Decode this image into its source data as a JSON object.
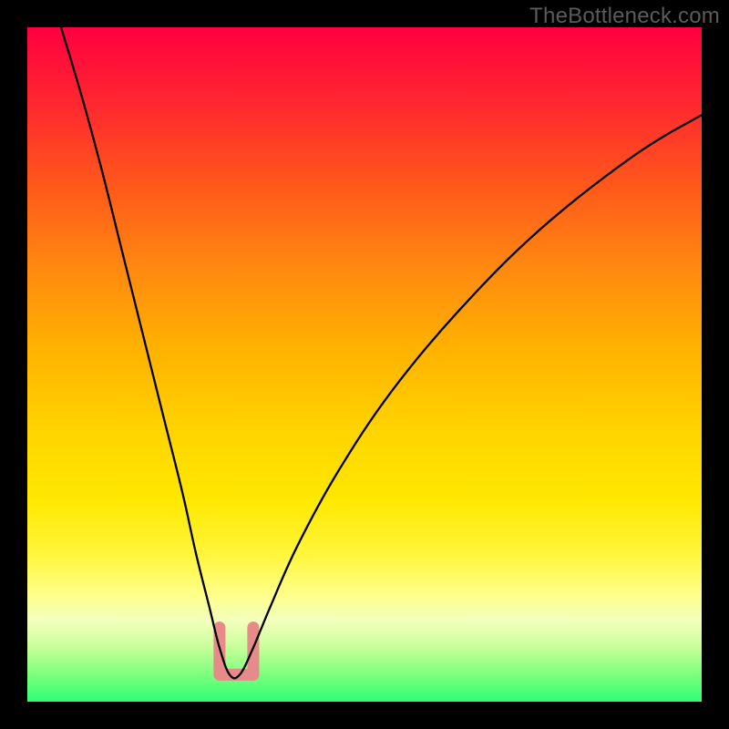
{
  "watermark": "TheBottleneck.com",
  "chart_data": {
    "type": "line",
    "title": "",
    "xlabel": "",
    "ylabel": "",
    "xlim": [
      0,
      100
    ],
    "ylim": [
      0,
      100
    ],
    "grid": false,
    "background_gradient": {
      "top_color": "#ff0040",
      "bottom_color": "#2cff76",
      "meaning": "high (red) to low (green) bottleneck"
    },
    "series": [
      {
        "name": "bottleneck-curve",
        "color": "#000000",
        "x": [
          5,
          8,
          11,
          14,
          17,
          20,
          23,
          25,
          27,
          28.5,
          30,
          31.5,
          33.5,
          36,
          40,
          46,
          54,
          64,
          76,
          90,
          100
        ],
        "values": [
          100,
          90,
          79,
          67,
          55,
          43,
          31,
          22,
          14,
          8,
          4,
          4,
          8,
          14,
          23,
          34,
          46,
          58,
          70,
          81,
          87
        ]
      }
    ],
    "markers": [
      {
        "name": "optimum-left",
        "x": 28.5,
        "y_top": 11,
        "y_bottom": 4,
        "color": "#e68a8a"
      },
      {
        "name": "optimum-right",
        "x": 33.5,
        "y_top": 11,
        "y_bottom": 4,
        "color": "#e68a8a"
      },
      {
        "name": "optimum-base",
        "x1": 28.5,
        "x2": 33.5,
        "y": 4,
        "color": "#e68a8a"
      }
    ]
  }
}
